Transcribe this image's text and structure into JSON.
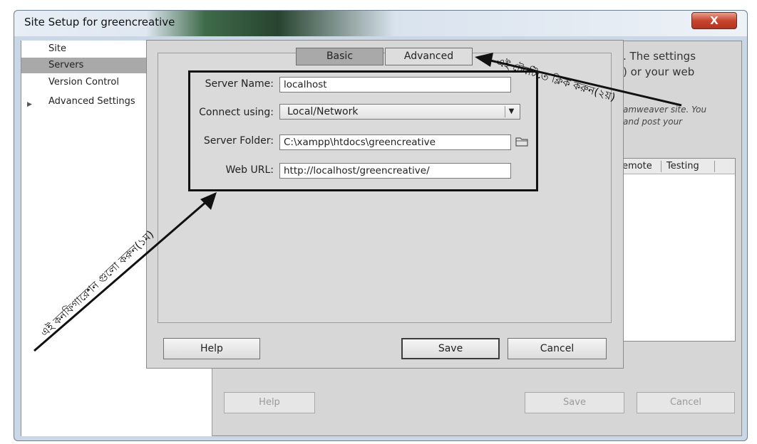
{
  "window": {
    "title": "Site Setup for greencreative",
    "close_glyph": "X"
  },
  "sidebar": {
    "items": [
      {
        "label": "Site"
      },
      {
        "label": "Servers"
      },
      {
        "label": "Version Control"
      },
      {
        "label": "Advanced Settings"
      }
    ],
    "expander_glyph": "▶"
  },
  "background": {
    "desc_line1": ". The settings",
    "desc_line2": ") or your web",
    "desc_line3": "amweaver site. You",
    "desc_line4": "and post your",
    "table_headers": [
      "emote",
      "Testing"
    ],
    "buttons": {
      "help": "Help",
      "save": "Save",
      "cancel": "Cancel"
    }
  },
  "dialog": {
    "tabs": {
      "basic": "Basic",
      "advanced": "Advanced"
    },
    "fields": {
      "server_name": {
        "label": "Server Name:",
        "value": "localhost"
      },
      "connect_using": {
        "label": "Connect using:",
        "value": "Local/Network"
      },
      "server_folder": {
        "label": "Server Folder:",
        "value": "C:\\xampp\\htdocs\\greencreative"
      },
      "web_url": {
        "label": "Web URL:",
        "value": "http://localhost/greencreative/"
      }
    },
    "buttons": {
      "help": "Help",
      "save": "Save",
      "cancel": "Cancel"
    }
  },
  "annotations": {
    "step1": "এই কনফিগারেশন গুলো করুন(১ম)",
    "step2": "এই টেবটিতে ক্লিক করুন(২য়)"
  },
  "colors": {
    "selected_row": "#a9a9a9",
    "close_button": "#c8452f",
    "highlight_box": "#111111"
  }
}
